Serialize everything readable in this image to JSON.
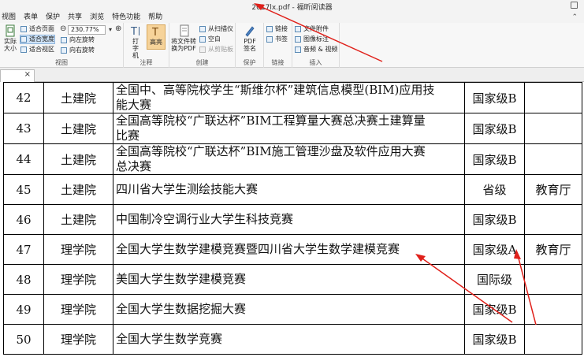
{
  "window": {
    "title": "2017lx.pdf - 福昕阅读器"
  },
  "menu": [
    "视图",
    "表单",
    "保护",
    "共享",
    "浏览",
    "特色功能",
    "帮助"
  ],
  "ribbon": {
    "view": {
      "actual_size": "实际大小",
      "fit_page": "适合页面",
      "fit_width": "适合宽度",
      "fit_visible": "适合视区",
      "zoom": "230.77%",
      "rotate_left": "向左旋转",
      "rotate_right": "向右旋转",
      "label": "视图"
    },
    "annotate": {
      "typewriter": "打字机",
      "highlight": "高亮",
      "label": "注释"
    },
    "create": {
      "convert": "将文件转换为PDF",
      "from_scanner": "从扫描仪",
      "blank": "空白",
      "from_clipboard": "从剪贴板",
      "label": "创建"
    },
    "protect": {
      "sign": "PDF签名",
      "label": "保护"
    },
    "links": {
      "link": "链接",
      "bookmark": "书签",
      "label": "链接"
    },
    "insert": {
      "attachment": "文件附件",
      "image": "图像标注",
      "media": "音频 & 视频",
      "label": "插入"
    }
  },
  "tab": {
    "close": "×"
  },
  "rows": [
    {
      "num": "42",
      "college": "土建院",
      "name_l1": "全国中、高等院校学生“斯维尔杯”建筑信息模型(BIM)应用技",
      "name_l2": "能大赛",
      "level": "国家级B",
      "org": ""
    },
    {
      "num": "43",
      "college": "土建院",
      "name_l1": "全国高等院校“广联达杯”BIM工程算量大赛总决赛土建算量",
      "name_l2": "比赛",
      "level": "国家级B",
      "org": ""
    },
    {
      "num": "44",
      "college": "土建院",
      "name_l1": "全国高等院校“广联达杯”BIM施工管理沙盘及软件应用大赛",
      "name_l2": "总决赛",
      "level": "国家级B",
      "org": ""
    },
    {
      "num": "45",
      "college": "土建院",
      "name_l1": "四川省大学生测绘技能大赛",
      "name_l2": "",
      "level": "省级",
      "org": "教育厅"
    },
    {
      "num": "46",
      "college": "土建院",
      "name_l1": "中国制冷空调行业大学生科技竞赛",
      "name_l2": "",
      "level": "国家级B",
      "org": ""
    },
    {
      "num": "47",
      "college": "理学院",
      "name_l1": "全国大学生数学建模竞赛暨四川省大学生数学建模竞赛",
      "name_l2": "",
      "level": "国家级A",
      "org": "教育厅"
    },
    {
      "num": "48",
      "college": "理学院",
      "name_l1": "美国大学生数学建模竞赛",
      "name_l2": "",
      "level": "国际级",
      "org": ""
    },
    {
      "num": "49",
      "college": "理学院",
      "name_l1": "全国大学生数据挖掘大赛",
      "name_l2": "",
      "level": "国家级B",
      "org": ""
    },
    {
      "num": "50",
      "college": "理学院",
      "name_l1": "全国大学生数学竞赛",
      "name_l2": "",
      "level": "国家级B",
      "org": ""
    }
  ],
  "colors": {
    "annotation": "#e0201a",
    "selected": "#cfe3f7"
  }
}
